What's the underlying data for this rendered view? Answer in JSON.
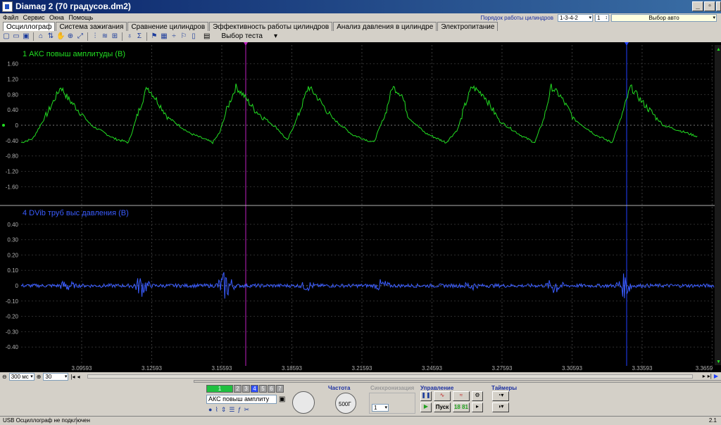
{
  "window": {
    "title": "Diamag 2 (70 градусов.dm2)",
    "controls": {
      "minimize": "_",
      "maximize": "▫",
      "close": "✕"
    }
  },
  "menu": [
    "Файл",
    "Сервис",
    "Окна",
    "Помощь"
  ],
  "cylinder_order": {
    "label": "Порядок работы цилиндров",
    "order": "1-3-4-2",
    "cylinder": "1",
    "auto_label": "Выбор авто"
  },
  "tabs": [
    {
      "label": "Осциллограф",
      "active": true
    },
    {
      "label": "Система зажигания",
      "active": false
    },
    {
      "label": "Сравнение цилиндров",
      "active": false
    },
    {
      "label": "Эффективность работы цилиндров",
      "active": false
    },
    {
      "label": "Анализ давления в цилиндре",
      "active": false
    },
    {
      "label": "Электропитание",
      "active": false
    }
  ],
  "toolbar": {
    "icons": [
      "new-icon",
      "open-icon",
      "save-icon",
      "sep",
      "cursor-icon",
      "markers-icon",
      "hand-icon",
      "zoom-icon",
      "fit-icon",
      "sep",
      "split-icon",
      "channels-icon",
      "overlay-icon",
      "sep",
      "ch-icon",
      "sigma-icon",
      "sep",
      "filter-icon",
      "table-icon",
      "divide-icon",
      "flag-icon",
      "page-icon"
    ],
    "test_select": "Выбор теста"
  },
  "chart_data": [
    {
      "type": "line",
      "title": "1 АКС повыш амплитуды (В)",
      "color": "#22dd22",
      "yticks": [
        "1.60",
        "1.20",
        "0.80",
        "0.40",
        "0",
        "-0.40",
        "-0.80",
        "-1.20",
        "-1.60"
      ],
      "ylim": [
        -2.0,
        2.0
      ],
      "x": [
        3.07,
        3.075,
        3.082,
        3.087,
        3.09,
        3.093,
        3.1,
        3.11,
        3.116,
        3.12,
        3.124,
        3.127,
        3.133,
        3.142,
        3.152,
        3.155,
        3.158,
        3.162,
        3.165,
        3.17,
        3.18,
        3.184,
        3.189,
        3.193,
        3.196,
        3.203,
        3.212,
        3.221,
        3.226,
        3.229,
        3.233,
        3.236,
        3.243,
        3.252,
        3.257,
        3.26,
        3.263,
        3.268,
        3.275,
        3.285,
        3.29,
        3.294,
        3.297,
        3.301,
        3.307,
        3.316,
        3.323,
        3.327,
        3.331,
        3.336,
        3.345,
        3.36
      ],
      "y": [
        -0.45,
        -0.35,
        0.4,
        1.0,
        0.7,
        0.5,
        0.0,
        -0.35,
        -0.45,
        0.3,
        1.0,
        0.75,
        0.2,
        -0.2,
        -0.45,
        -0.2,
        0.4,
        1.0,
        0.8,
        0.4,
        -0.1,
        -0.4,
        0.3,
        1.0,
        0.8,
        0.2,
        -0.25,
        -0.45,
        0.3,
        1.0,
        0.8,
        0.2,
        -0.2,
        -0.45,
        -0.1,
        0.5,
        1.0,
        0.8,
        0.1,
        -0.3,
        -0.45,
        0.2,
        1.0,
        0.75,
        0.15,
        -0.25,
        -0.45,
        0.2,
        1.0,
        0.6,
        0.0,
        -0.3
      ]
    },
    {
      "type": "line",
      "title": "4 DVib труб выс давления (В)",
      "color": "#3a5cff",
      "yticks": [
        "0.40",
        "0.30",
        "0.20",
        "0.10",
        "0",
        "-0.10",
        "-0.20",
        "-0.30",
        "-0.40"
      ],
      "ylim": [
        -0.5,
        0.5
      ],
      "bursts": [
        {
          "x": 3.0895,
          "amp": 0.05
        },
        {
          "x": 3.1215,
          "amp": 0.08
        },
        {
          "x": 3.1575,
          "amp": 0.11
        },
        {
          "x": 3.1925,
          "amp": 0.04
        },
        {
          "x": 3.2245,
          "amp": 0.05
        },
        {
          "x": 3.2625,
          "amp": 0.04
        },
        {
          "x": 3.2985,
          "amp": 0.07
        },
        {
          "x": 3.3285,
          "amp": 0.09
        }
      ],
      "xticks": [
        "3.09593",
        "3.12593",
        "3.15593",
        "3.18593",
        "3.21593",
        "3.24593",
        "3.27593",
        "3.30593",
        "3.33593",
        "3.3659"
      ],
      "xlim": [
        3.07,
        3.367
      ]
    }
  ],
  "bottom": {
    "timebase": "300 мс",
    "count": "30",
    "channels": [
      "1",
      "2",
      "3",
      "4",
      "5",
      "6",
      "7"
    ],
    "channel_name": "АКС повыш амплиту",
    "freq_label": "Частота",
    "freq_value": "500Г",
    "sync_label": "Синхронизация",
    "sync_value": "1",
    "control_label": "Управление",
    "start_label": "Пуск",
    "counter": "18 81",
    "timers_label": "Таймеры"
  },
  "status": {
    "left": "USB Осциллограф не подключен",
    "right": "2.1"
  }
}
